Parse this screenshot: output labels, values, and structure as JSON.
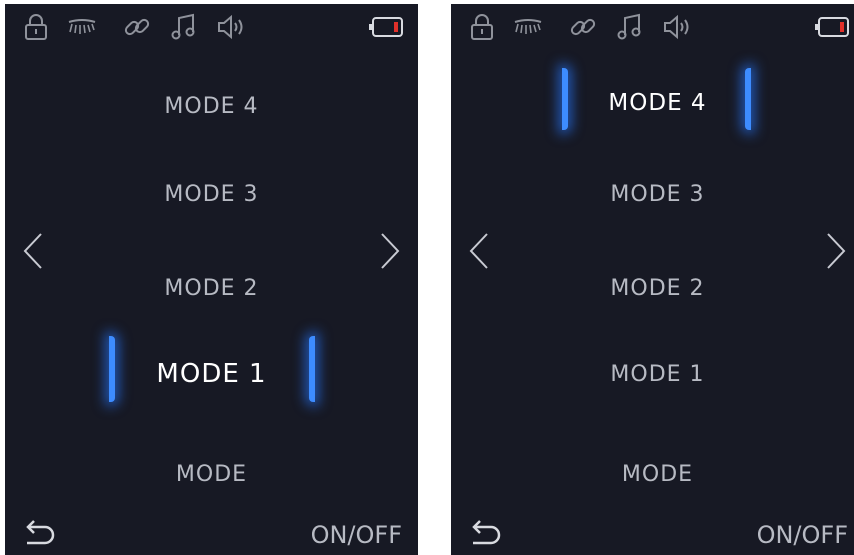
{
  "colors": {
    "background": "#171924",
    "text": "#b7bac3",
    "selected_text": "#ffffff",
    "glow": "#3d8cff",
    "battery_indicator": "#e0302a"
  },
  "screens": [
    {
      "icons": [
        "lock-icon",
        "lashes-icon",
        "link-icon",
        "music-icon",
        "speaker-icon",
        "battery-icon"
      ],
      "modes": [
        "MODE 4",
        "MODE 3",
        "MODE 2",
        "MODE 1",
        "MODE"
      ],
      "selected": "MODE 1",
      "onoff_label": "ON/OFF"
    },
    {
      "icons": [
        "lock-icon",
        "lashes-icon",
        "link-icon",
        "music-icon",
        "speaker-icon",
        "battery-icon"
      ],
      "modes": [
        "MODE 4",
        "MODE 3",
        "MODE 2",
        "MODE 1",
        "MODE"
      ],
      "selected": "MODE 4",
      "onoff_label": "ON/OFF"
    }
  ]
}
